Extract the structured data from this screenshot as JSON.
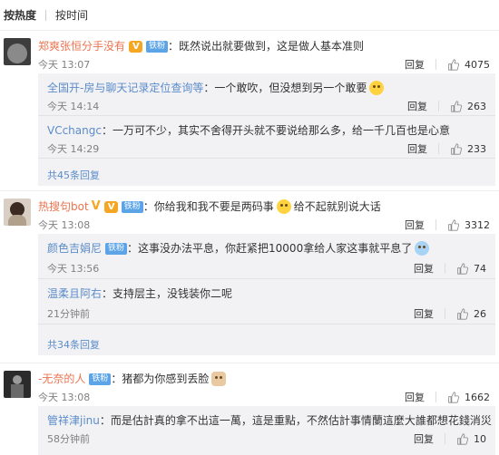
{
  "sort": {
    "hot": "按热度",
    "time": "按时间"
  },
  "actions": {
    "reply": "回复"
  },
  "comments": [
    {
      "user": "郑爽张恒分手没有",
      "fan_badge": "铁粉",
      "text": "：既然说出就要做到，这是做人基本准则",
      "time": "今天 13:07",
      "likes": "4075",
      "replies": [
        {
          "user": "全国开-房与聊天记录定位查询等",
          "text": "：一个敢吹，但没想到另一个敢要",
          "time": "今天 14:14",
          "likes": "263"
        },
        {
          "user": "VCchangc",
          "text": "：一万可不少，其实不舍得开头就不要说给那么多，给一千几百也是心意",
          "time": "今天 14:29",
          "likes": "233"
        }
      ],
      "more": "共45条回复"
    },
    {
      "user": "热搜句bot",
      "fan_badge": "铁粉",
      "text": "：你给我和我不要是两码事",
      "text2": "给不起就别说大话",
      "time": "今天 13:08",
      "likes": "3312",
      "replies": [
        {
          "user": "颜色吉娟尼",
          "fan_badge": "铁粉",
          "text": "：这事没办法平息，你赶紧把10000拿给人家这事就平息了",
          "time": "今天 13:56",
          "likes": "74"
        },
        {
          "user": "温柔且阿右",
          "text": "：支持层主，没钱装你二呢",
          "time": "21分钟前",
          "likes": "26"
        }
      ],
      "more": "共34条回复"
    },
    {
      "user": "-无奈的人",
      "fan_badge": "铁粉",
      "text": "：猪都为你感到丢脸",
      "time": "今天 13:08",
      "likes": "1662",
      "replies": [
        {
          "user": "管祥津jinu",
          "text": "：而是估計真的拿不出這一萬，這是重點，不然估計事情蘭這麼大誰都想花錢消災",
          "time": "58分钟前",
          "likes": "10"
        }
      ]
    }
  ]
}
